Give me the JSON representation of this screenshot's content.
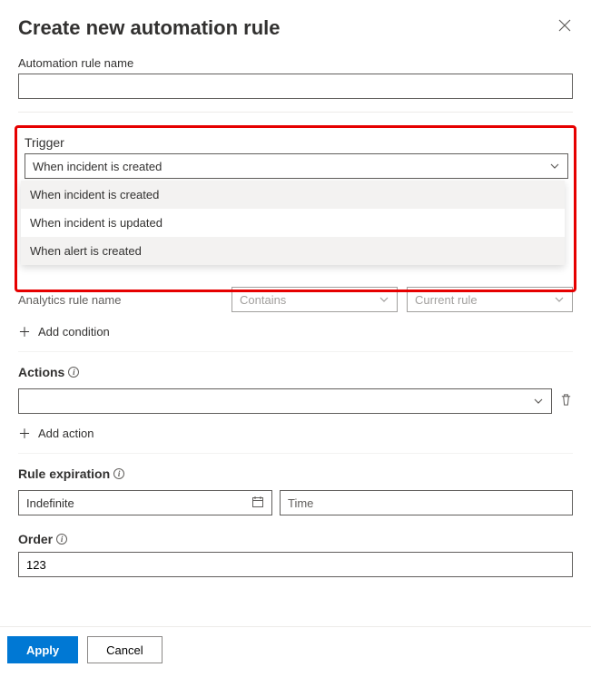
{
  "header": {
    "title": "Create new automation rule"
  },
  "name": {
    "label": "Automation rule name",
    "value": ""
  },
  "trigger": {
    "label": "Trigger",
    "selected": "When incident is created",
    "options": [
      "When incident is created",
      "When incident is updated",
      "When alert is created"
    ]
  },
  "conditions": {
    "rule_label": "Analytics rule name",
    "operator_selected": "Contains",
    "value_selected": "Current rule",
    "add_label": "Add condition"
  },
  "actions": {
    "label": "Actions",
    "selected": "",
    "add_label": "Add action"
  },
  "expiration": {
    "label": "Rule expiration",
    "date_value": "Indefinite",
    "time_placeholder": "Time"
  },
  "order": {
    "label": "Order",
    "value": "123"
  },
  "footer": {
    "apply": "Apply",
    "cancel": "Cancel"
  }
}
